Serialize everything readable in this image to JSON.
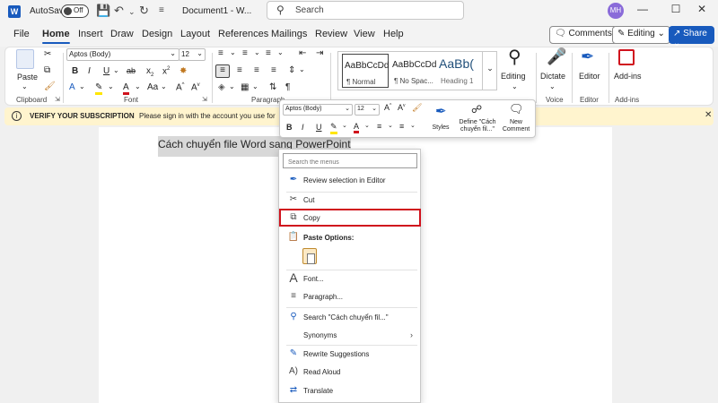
{
  "titlebar": {
    "autosave_label": "AutoSave",
    "autosave_state": "Off",
    "doc_title": "Document1 - W...",
    "search_placeholder": "Search",
    "avatar_initials": "MH"
  },
  "tabs": [
    "File",
    "Home",
    "Insert",
    "Draw",
    "Design",
    "Layout",
    "References",
    "Mailings",
    "Review",
    "View",
    "Help"
  ],
  "active_tab": "Home",
  "tab_buttons": {
    "comments": "Comments",
    "editing": "Editing",
    "share": "Share"
  },
  "ribbon": {
    "paste_label": "Paste",
    "font_name": "Aptos (Body)",
    "font_size": "12",
    "styles": [
      {
        "sample": "AaBbCcDd",
        "name": "¶ Normal"
      },
      {
        "sample": "AaBbCcDd",
        "name": "¶ No Spac..."
      },
      {
        "sample": "AaBb(",
        "name": "Heading 1"
      }
    ],
    "editing_label": "Editing",
    "dictate_label": "Dictate",
    "editor_label": "Editor",
    "addins_label": "Add-ins",
    "group_labels": {
      "clipboard": "Clipboard",
      "font": "Font",
      "paragraph": "Paragraph",
      "voice": "Voice",
      "editor": "Editor",
      "addins": "Add-ins"
    }
  },
  "notification": {
    "title": "VERIFY YOUR SUBSCRIPTION",
    "message": "Please sign in with the account you use for"
  },
  "document": {
    "selected_text": "Cách chuyển file Word sang PowerPoint"
  },
  "mini_toolbar": {
    "font_name": "Aptos (Body)",
    "font_size": "12",
    "styles_label": "Styles",
    "define_label": "Define \"Cách chuyển fil...\"",
    "new_comment_label": "New Comment"
  },
  "context_menu": {
    "search_placeholder": "Search the menus",
    "items": {
      "review_selection": "Review selection in Editor",
      "cut": "Cut",
      "copy": "Copy",
      "paste_options": "Paste Options:",
      "font": "Font...",
      "paragraph": "Paragraph...",
      "search": "Search \"Cách chuyển fil...\"",
      "synonyms": "Synonyms",
      "rewrite": "Rewrite Suggestions",
      "read_aloud": "Read Aloud",
      "translate": "Translate"
    },
    "highlighted_item": "Copy"
  },
  "colors": {
    "accent": "#185abd",
    "highlight_border": "#d0121d",
    "notification_bg": "#fff4ce",
    "selection_bg": "#d8d8d8"
  }
}
